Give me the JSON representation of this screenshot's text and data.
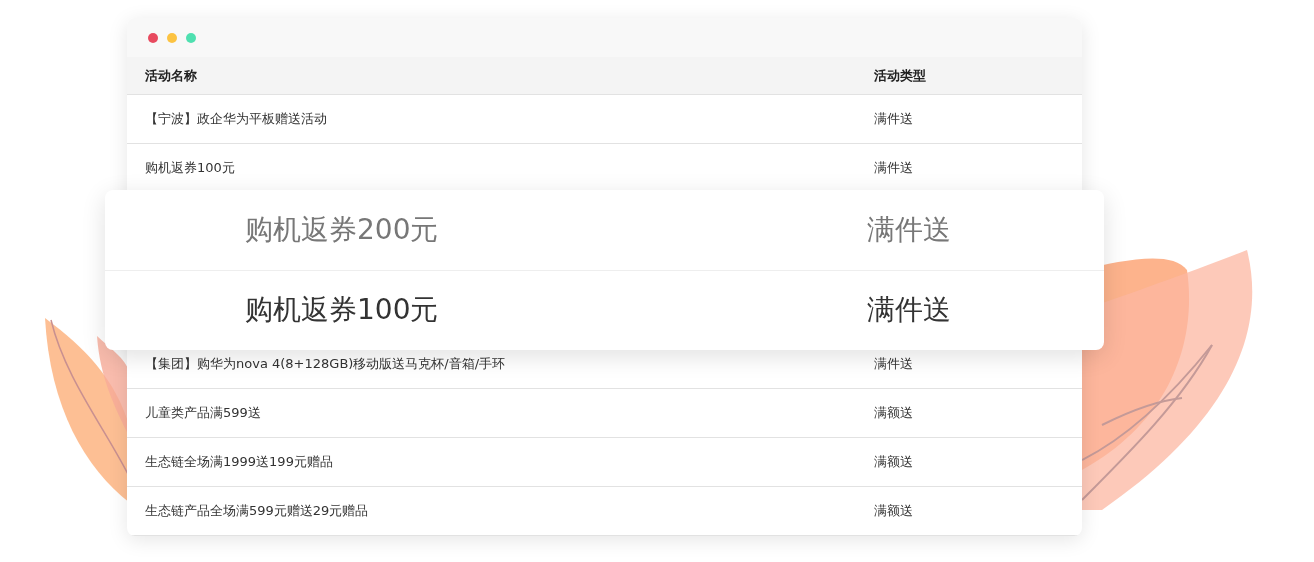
{
  "window": {
    "controls": [
      {
        "color": "#e84a5f"
      },
      {
        "color": "#fcc342"
      },
      {
        "color": "#4fe0b0"
      }
    ]
  },
  "table": {
    "columns": [
      "活动名称",
      "活动类型"
    ],
    "rows_top": [
      {
        "name": "【宁波】政企华为平板赠送活动",
        "type": "满件送"
      },
      {
        "name": "购机返券100元",
        "type": "满件送"
      }
    ],
    "rows_bottom": [
      {
        "name": "【集团】购华为nova 4(8+128GB)移动版送马克杯/音箱/手环",
        "type": "满件送"
      },
      {
        "name": "儿童类产品满599送",
        "type": "满额送"
      },
      {
        "name": "生态链全场满1999送199元赠品",
        "type": "满额送"
      },
      {
        "name": "生态链产品全场满599元赠送29元赠品",
        "type": "满额送"
      }
    ]
  },
  "zoom_card": {
    "rows": [
      {
        "name": "购机返券200元",
        "type": "满件送",
        "selected": false
      },
      {
        "name": "购机返券100元",
        "type": "满件送",
        "selected": true
      }
    ]
  }
}
